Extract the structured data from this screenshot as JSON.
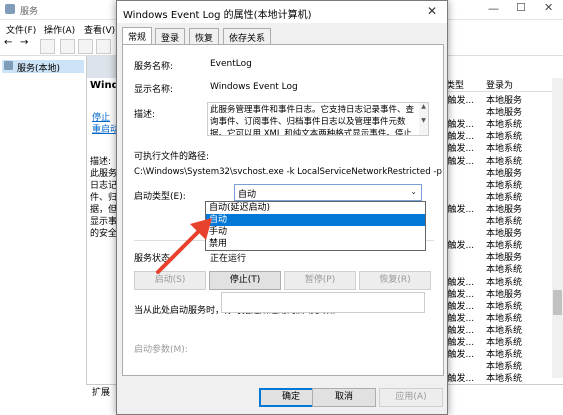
{
  "bg": {
    "title": "服务",
    "menu": [
      "文件(F)",
      "操作(A)",
      "查看(V)"
    ],
    "tree_item": "服务(本地)",
    "mid_title": "Wind",
    "mid_links": [
      "停止",
      "重启动"
    ],
    "mid_desc": [
      "描述:",
      "此服务",
      "日志记",
      "件、归",
      "据，但",
      "显示事",
      "的安全"
    ],
    "list_header": "类型",
    "list_header_full": "启动类型",
    "list_header_right": "登录为",
    "list_rows": [
      {
        "type": "(触发...",
        "logon": "本地服务"
      },
      {
        "type": "",
        "logon": "本地服务"
      },
      {
        "type": "(触发...",
        "logon": "本地系统"
      },
      {
        "type": "(触发...",
        "logon": "本地系统"
      },
      {
        "type": "(触发...",
        "logon": "本地系统"
      },
      {
        "type": "(触发...",
        "logon": "本地系统"
      },
      {
        "type": "",
        "logon": "本地服务"
      },
      {
        "type": "",
        "logon": "本地系统"
      },
      {
        "type": "",
        "logon": "本地系统"
      },
      {
        "type": "(触发...",
        "logon": "本地服务"
      },
      {
        "type": "",
        "logon": "本地系统"
      },
      {
        "type": "",
        "logon": "本地服务"
      },
      {
        "type": "(触发...",
        "logon": "本地系统"
      },
      {
        "type": "",
        "logon": "本地服务"
      },
      {
        "type": "",
        "logon": "本地系统"
      },
      {
        "type": "(触发...",
        "logon": "本地系统"
      },
      {
        "type": "(触发...",
        "logon": "本地服务"
      },
      {
        "type": "(触发...",
        "logon": "本地系统"
      },
      {
        "type": "(触发...",
        "logon": "本地系统"
      },
      {
        "type": "(触发...",
        "logon": "本地系统"
      },
      {
        "type": "(触发...",
        "logon": "本地系统"
      },
      {
        "type": "(触发...",
        "logon": "本地系统"
      },
      {
        "type": "",
        "logon": "本地系统"
      },
      {
        "type": "(触发...",
        "logon": "本地系统"
      }
    ],
    "status_tab": "扩展"
  },
  "dialog": {
    "title": "Windows Event Log 的属性(本地计算机)",
    "close": "✕",
    "tabs": [
      "常规",
      "登录",
      "恢复",
      "依存关系"
    ],
    "service_name_label": "服务名称:",
    "service_name": "EventLog",
    "display_name_label": "显示名称:",
    "display_name": "Windows Event Log",
    "description_label": "描述:",
    "description": "此服务管理事件和事件日志。它支持日志记录事件、查询事件、订阅事件、归档事件日志以及管理事件元数据。它可以用 XML 和纯文本两种格式显示事件。停止该",
    "path_label": "可执行文件的路径:",
    "path": "C:\\Windows\\System32\\svchost.exe -k LocalServiceNetworkRestricted -p",
    "startup_label": "启动类型(E):",
    "startup_value": "自动",
    "startup_options": [
      "自动(延迟启动)",
      "自动",
      "手动",
      "禁用"
    ],
    "startup_selected_index": 1,
    "status_label": "服务状态:",
    "status_value": "正在运行",
    "buttons": {
      "start": "启动(S)",
      "stop": "停止(T)",
      "pause": "暂停(P)",
      "resume": "恢复(R)"
    },
    "hint": "当从此处启动服务时，你可指定所适用的启动参数。",
    "param_label": "启动参数(M):",
    "ok": "确定",
    "cancel": "取消",
    "apply": "应用(A)"
  },
  "colors": {
    "accent": "#0078d7",
    "arrow": "#e8412c"
  }
}
